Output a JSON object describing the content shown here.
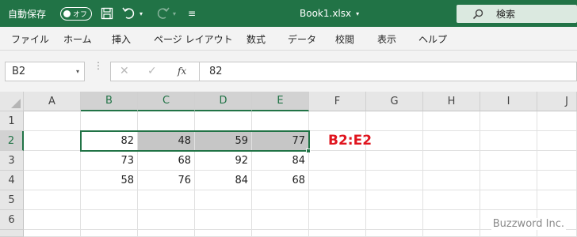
{
  "titlebar": {
    "autosave_label": "自動保存",
    "autosave_state": "オフ",
    "doc_title": "Book1.xlsx",
    "search_placeholder": "検索"
  },
  "ribbon": {
    "tabs": [
      "ファイル",
      "ホーム",
      "挿入",
      "ページ レイアウト",
      "数式",
      "データ",
      "校閲",
      "表示",
      "ヘルプ"
    ]
  },
  "formula_bar": {
    "name_box": "B2",
    "fx_label": "fx",
    "value": "82"
  },
  "sheet": {
    "columns": [
      "A",
      "B",
      "C",
      "D",
      "E",
      "F",
      "G",
      "H",
      "I",
      "J"
    ],
    "rows": [
      "1",
      "2",
      "3",
      "4",
      "5",
      "6",
      "7"
    ],
    "cells": {
      "B2": "82",
      "C2": "48",
      "D2": "59",
      "E2": "77",
      "B3": "73",
      "C3": "68",
      "D3": "92",
      "E3": "84",
      "B4": "58",
      "C4": "76",
      "D4": "84",
      "E4": "68"
    },
    "active_cell": "B2",
    "selected_range": "B2:E2",
    "selected_columns": [
      "B",
      "C",
      "D",
      "E"
    ],
    "selected_row": "2"
  },
  "annotation": {
    "label": "B2:E2",
    "color": "#e0141e"
  },
  "watermark": "Buzzword Inc.",
  "colors": {
    "brand": "#217346",
    "selection_fill": "#c6c6c6"
  },
  "icons": [
    "toggle-switch",
    "save-icon",
    "undo-icon",
    "redo-icon",
    "customize-qat-icon",
    "search-icon",
    "cancel-icon",
    "enter-icon",
    "select-all-icon"
  ]
}
